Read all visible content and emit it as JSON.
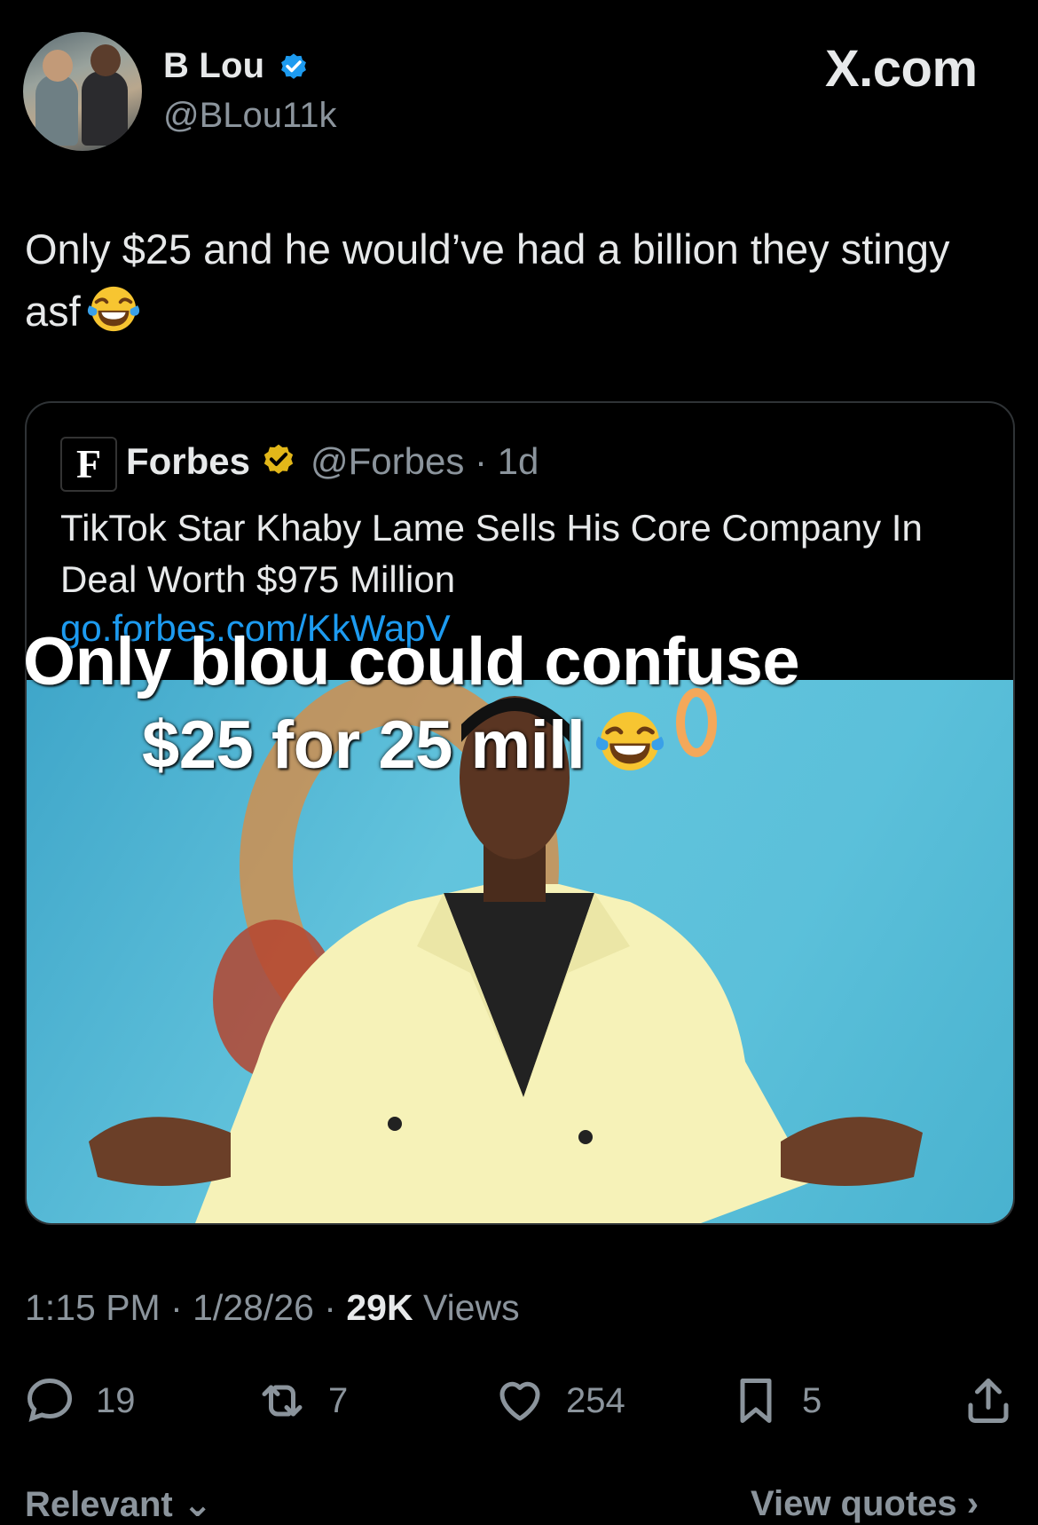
{
  "author": {
    "display_name": "B Lou",
    "handle": "@BLou11k"
  },
  "site_label": "X.com",
  "tweet": {
    "text": "Only $25 and he would’ve had a billion they stingy asf",
    "emoji": "face-with-tears-of-joy"
  },
  "quote": {
    "logo_letter": "F",
    "name": "Forbes",
    "meta": "@Forbes · 1d",
    "text": "TikTok Star Khaby Lame Sells His Core Company In Deal Worth $975 Million",
    "link": "go.forbes.com/KkWapV"
  },
  "overlay_caption": {
    "line1": "Only blou could confuse",
    "line2": "$25 for 25 mill"
  },
  "meta": {
    "time": "1:15 PM · 1/28/26 · ",
    "views_count": "29K",
    "views_label": " Views"
  },
  "actions": {
    "replies": "19",
    "reposts": "7",
    "likes": "254",
    "bookmarks": "5"
  },
  "footer": {
    "relevant": "Relevant ⌄",
    "view_quotes": "View quotes ›"
  },
  "colors": {
    "background": "#000000",
    "text": "#e7e9ea",
    "secondary": "#8b949c",
    "link": "#1d9bf0",
    "verified_blue": "#1d9bf0",
    "verified_gold": "#e2b719"
  }
}
